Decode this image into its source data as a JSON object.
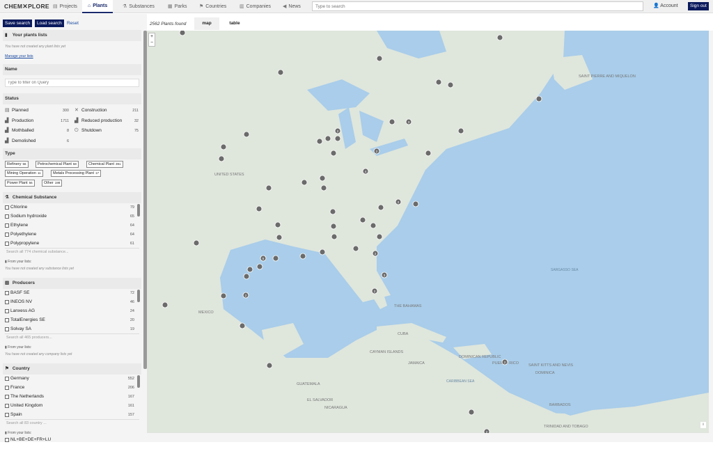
{
  "logo": {
    "text_left": "CHEM",
    "text_right": "PLORE"
  },
  "nav": {
    "tabs": [
      {
        "label": "Projects",
        "icon": "document-icon"
      },
      {
        "label": "Plants",
        "icon": "plant-icon"
      },
      {
        "label": "Substances",
        "icon": "flask-icon"
      },
      {
        "label": "Parks",
        "icon": "grid-icon"
      },
      {
        "label": "Countries",
        "icon": "flag-icon"
      },
      {
        "label": "Companies",
        "icon": "building-icon"
      },
      {
        "label": "News",
        "icon": "megaphone-icon"
      }
    ],
    "active": "Plants",
    "search_placeholder": "Type to search",
    "account": "Account",
    "signout": "Sign out"
  },
  "sidebar": {
    "save_search": "Save search",
    "load_search": "Load search",
    "reset": "Reset",
    "lists": {
      "title": "Your plants lists",
      "note": "You have not created any plant lists yet",
      "manage": "Manage your lists"
    },
    "name": {
      "title": "Name",
      "placeholder": "Type to filter on Query"
    },
    "status": {
      "title": "Status",
      "items": [
        {
          "label": "Planned",
          "count": "300"
        },
        {
          "label": "Construction",
          "count": "211"
        },
        {
          "label": "Production",
          "count": "1711"
        },
        {
          "label": "Reduced production",
          "count": "32"
        },
        {
          "label": "Mothballed",
          "count": "8"
        },
        {
          "label": "Shutdown",
          "count": "75"
        },
        {
          "label": "Demolished",
          "count": "6"
        }
      ]
    },
    "type": {
      "title": "Type",
      "tags": [
        {
          "label": "Refinery",
          "count": "56"
        },
        {
          "label": "Petrochemical Plant",
          "count": "58"
        },
        {
          "label": "Chemical Plant",
          "count": "391"
        },
        {
          "label": "Mining Operation",
          "count": "11"
        },
        {
          "label": "Metals Processing Plant",
          "count": "17"
        },
        {
          "label": "Power Plant",
          "count": "56"
        },
        {
          "label": "Other",
          "count": "198"
        }
      ]
    },
    "chemical": {
      "title": "Chemical Substance",
      "items": [
        {
          "label": "Chlorine",
          "count": "79"
        },
        {
          "label": "Sodium hydroxide",
          "count": "65"
        },
        {
          "label": "Ethylene",
          "count": "64"
        },
        {
          "label": "Polyethylene",
          "count": "64"
        },
        {
          "label": "Polypropylene",
          "count": "61"
        }
      ],
      "search_all": "Search all 774 chemical substance...",
      "from_lists": "From your lists:",
      "note": "You have not created any substance lists yet"
    },
    "producers": {
      "title": "Producers",
      "items": [
        {
          "label": "BASF SE",
          "count": "72"
        },
        {
          "label": "INEOS NV",
          "count": "46"
        },
        {
          "label": "Lanxess AG",
          "count": "24"
        },
        {
          "label": "TotalEnergies SE",
          "count": "20"
        },
        {
          "label": "Solvay SA",
          "count": "19"
        }
      ],
      "search_all": "Search all 465 producers...",
      "from_lists": "From your lists:",
      "note": "You have not created any company lists yet"
    },
    "country": {
      "title": "Country",
      "items": [
        {
          "label": "Germany",
          "count": "552"
        },
        {
          "label": "France",
          "count": "206"
        },
        {
          "label": "The Netherlands",
          "count": "167"
        },
        {
          "label": "United Kingdom",
          "count": "161"
        },
        {
          "label": "Spain",
          "count": "157"
        }
      ],
      "search_all": "Search all 83 country ...",
      "from_lists": "From your lists:",
      "list_item": "NL+BE+DE+FR+LU"
    }
  },
  "results": {
    "found": "2562 Plants found",
    "view_map": "map",
    "view_table": "table"
  },
  "map": {
    "zoom_in": "+",
    "zoom_out": "−",
    "info": "i",
    "labels": [
      {
        "text": "UNITED STATES",
        "kind": "country"
      },
      {
        "text": "MEXICO",
        "kind": "country"
      },
      {
        "text": "CUBA",
        "kind": "country"
      },
      {
        "text": "GUATEMALA",
        "kind": "country"
      },
      {
        "text": "NICARAGUA",
        "kind": "country"
      },
      {
        "text": "EL SALVADOR",
        "kind": "country"
      },
      {
        "text": "CAYMAN ISLANDS",
        "kind": "country"
      },
      {
        "text": "JAMAICA",
        "kind": "country"
      },
      {
        "text": "THE BAHAMAS",
        "kind": "country"
      },
      {
        "text": "DOMINICAN REPUBLIC",
        "kind": "country"
      },
      {
        "text": "PUERTO RICO",
        "kind": "country"
      },
      {
        "text": "SAINT KITTS AND NEVIS",
        "kind": "country"
      },
      {
        "text": "DOMINICA",
        "kind": "country"
      },
      {
        "text": "BARBADOS",
        "kind": "country"
      },
      {
        "text": "TRINIDAD AND TOBAGO",
        "kind": "country"
      },
      {
        "text": "SAINT PIERRE AND MIQUELON",
        "kind": "country"
      },
      {
        "text": "SARGASSO SEA",
        "kind": "sea"
      },
      {
        "text": "CARIBBEAN SEA",
        "kind": "sea"
      }
    ],
    "marker_labels": [
      "2",
      "3",
      "2",
      "2",
      "2",
      "5",
      "3",
      "2",
      "2",
      "2",
      "2",
      "4"
    ]
  },
  "colors": {
    "accent": "#0a1a5c",
    "land": "#dfe6dc",
    "water": "#a9cdea",
    "marker": "#6b6b6b"
  }
}
